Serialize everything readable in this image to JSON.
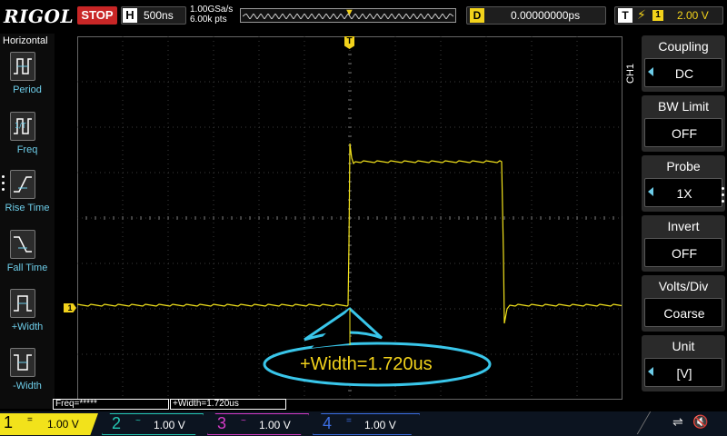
{
  "top": {
    "brand": "RIGOL",
    "run_state": "STOP",
    "timebase_tag": "H",
    "timebase": "500ns",
    "sample_rate": "1.00GSa/s",
    "points": "6.00k pts",
    "delay_tag": "D",
    "delay": "0.00000000ps",
    "trigger_tag": "T",
    "trigger_source": "1",
    "trigger_level": "2.00 V"
  },
  "left_menu": {
    "title": "Horizontal",
    "items": [
      {
        "label": "Period",
        "icon": "period-icon"
      },
      {
        "label": "Freq",
        "icon": "freq-icon"
      },
      {
        "label": "Rise Time",
        "icon": "rise-time-icon"
      },
      {
        "label": "Fall Time",
        "icon": "fall-time-icon"
      },
      {
        "label": "+Width",
        "icon": "pos-width-icon"
      },
      {
        "label": "-Width",
        "icon": "neg-width-icon"
      }
    ]
  },
  "right_menu": {
    "channel": "CH1",
    "items": [
      {
        "title": "Coupling",
        "value": "DC"
      },
      {
        "title": "BW Limit",
        "value": "OFF"
      },
      {
        "title": "Probe",
        "value": "1X"
      },
      {
        "title": "Invert",
        "value": "OFF"
      },
      {
        "title": "Volts/Div",
        "value": "Coarse"
      },
      {
        "title": "Unit",
        "value": "[V]"
      }
    ]
  },
  "measurements": {
    "freq": "Freq=*****",
    "width": "+Width=1.720us",
    "callout": "+Width=1.720us"
  },
  "markers": {
    "trigger_position": "T",
    "trigger_level": "T",
    "ch1_ground": "1"
  },
  "channels": [
    {
      "num": "1",
      "coupling": "=",
      "scale": "1.00 V"
    },
    {
      "num": "2",
      "coupling": "~",
      "scale": "1.00 V"
    },
    {
      "num": "3",
      "coupling": "~",
      "scale": "1.00 V"
    },
    {
      "num": "4",
      "coupling": "=",
      "scale": "1.00 V"
    }
  ],
  "colors": {
    "ch1": "#f2e21b",
    "ch2": "#24c9b5",
    "ch3": "#d63cc8",
    "ch4": "#3c6ee3",
    "accent": "#6dcde9",
    "stop": "#c82626"
  }
}
